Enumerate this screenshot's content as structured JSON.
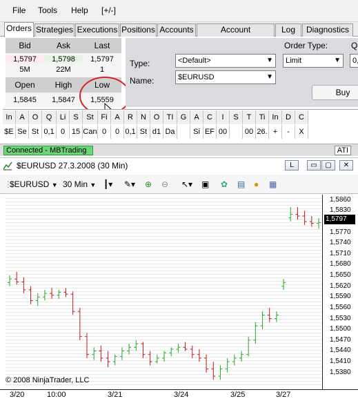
{
  "menu": {
    "file": "File",
    "tools": "Tools",
    "help": "Help",
    "toggle": "[+/-]"
  },
  "tabs": [
    "Orders",
    "Strategies",
    "Executions",
    "Positions",
    "Accounts",
    "Account Performance",
    "Log",
    "Diagnostics"
  ],
  "quote": {
    "bid_label": "Bid",
    "ask_label": "Ask",
    "last_label": "Last",
    "bid": "1,5797",
    "ask": "1,5798",
    "last": "1,5797",
    "bid_size": "5M",
    "ask_size": "22M",
    "last_size": "1",
    "open_label": "Open",
    "high_label": "High",
    "low_label": "Low",
    "open": "1,5845",
    "high": "1,5847",
    "low": "1,5559"
  },
  "order": {
    "type_label": "Type:",
    "type_value": "<Default>",
    "name_label": "Name:",
    "name_value": "$EURUSD",
    "order_type_label": "Order Type:",
    "order_type_value": "Limit",
    "qty_label": "Q",
    "qty_value": "0,",
    "buy_label": "Buy"
  },
  "columns": {
    "headers": [
      "In",
      "A",
      "O",
      "Q",
      "Li",
      "S",
      "St",
      "Fi",
      "A",
      "R",
      "N",
      "O",
      "TI",
      "G",
      "A",
      "C",
      "I",
      "S",
      "T",
      "Ti",
      "In",
      "D",
      "C"
    ],
    "values": [
      "$E",
      "Se",
      "St",
      "0,1",
      "0",
      "15",
      "Can",
      "0",
      "0",
      "0,1",
      "St",
      "d1",
      "Da",
      "",
      "Si",
      "EF",
      "00",
      "",
      "00",
      "26.",
      "+",
      "-",
      "X"
    ]
  },
  "status": {
    "connection": "Connected - MBTrading",
    "ati": "ATI"
  },
  "chart_window": {
    "title": "$EURUSD  27.3.2008 (30 Min)",
    "btn_l": "L",
    "btn_min": "▭",
    "btn_max": "▢",
    "btn_close": "✕"
  },
  "toolbar": {
    "instrument": "$EURUSD",
    "interval": "30 Min"
  },
  "chart_data": {
    "type": "bar",
    "instrument": "$EURUSD",
    "interval": "30 Min",
    "ylim": [
      1.5345,
      1.5865
    ],
    "y_ticks": [
      "1,5860",
      "1,5830",
      "1,5800",
      "1,5770",
      "1,5740",
      "1,5710",
      "1,5680",
      "1,5650",
      "1,5620",
      "1,5590",
      "1,5560",
      "1,5530",
      "1,5500",
      "1,5470",
      "1,5440",
      "1,5410",
      "1,5380"
    ],
    "x_ticks": [
      "3/20",
      "10:00",
      "3/21",
      "3/24",
      "3/25",
      "3/27"
    ],
    "last_price": "1,5797",
    "copyright": "© 2008 NinjaTrader, LLC",
    "bars": [
      [
        1.563,
        1.565,
        1.562,
        1.564
      ],
      [
        1.564,
        1.566,
        1.5625,
        1.5632
      ],
      [
        1.5632,
        1.5645,
        1.56,
        1.561
      ],
      [
        1.561,
        1.562,
        1.557,
        1.558
      ],
      [
        1.558,
        1.56,
        1.5565,
        1.559
      ],
      [
        1.559,
        1.561,
        1.558,
        1.56
      ],
      [
        1.56,
        1.5615,
        1.5585,
        1.5595
      ],
      [
        1.5595,
        1.561,
        1.5585,
        1.5603
      ],
      [
        1.5603,
        1.5615,
        1.559,
        1.5598
      ],
      [
        1.5598,
        1.5605,
        1.554,
        1.555
      ],
      [
        1.555,
        1.556,
        1.547,
        1.548
      ],
      [
        1.548,
        1.549,
        1.542,
        1.543
      ],
      [
        1.543,
        1.545,
        1.5415,
        1.544
      ],
      [
        1.544,
        1.5455,
        1.541,
        1.542
      ],
      [
        1.542,
        1.544,
        1.5395,
        1.541
      ],
      [
        1.541,
        1.543,
        1.54,
        1.5425
      ],
      [
        1.5425,
        1.545,
        1.5415,
        1.544
      ],
      [
        1.544,
        1.546,
        1.543,
        1.545
      ],
      [
        1.545,
        1.547,
        1.544,
        1.546
      ],
      [
        1.546,
        1.5465,
        1.542,
        1.543
      ],
      [
        1.543,
        1.544,
        1.54,
        1.541
      ],
      [
        1.541,
        1.543,
        1.5405,
        1.542
      ],
      [
        1.542,
        1.544,
        1.541,
        1.5435
      ],
      [
        1.5435,
        1.545,
        1.5425,
        1.5445
      ],
      [
        1.5445,
        1.546,
        1.5435,
        1.545
      ],
      [
        1.545,
        1.5465,
        1.544,
        1.5445
      ],
      [
        1.5445,
        1.5455,
        1.542,
        1.543
      ],
      [
        1.543,
        1.5445,
        1.541,
        1.542
      ],
      [
        1.542,
        1.543,
        1.538,
        1.539
      ],
      [
        1.539,
        1.541,
        1.536,
        1.537
      ],
      [
        1.537,
        1.54,
        1.536,
        1.539
      ],
      [
        1.539,
        1.542,
        1.538,
        1.541
      ],
      [
        1.541,
        1.543,
        1.54,
        1.542
      ],
      [
        1.542,
        1.544,
        1.541,
        1.543
      ],
      [
        1.543,
        1.548,
        1.5425,
        1.547
      ],
      [
        1.547,
        1.552,
        1.546,
        1.551
      ],
      [
        1.551,
        1.555,
        1.55,
        1.554
      ],
      [
        1.554,
        1.556,
        1.552,
        1.553
      ],
      [
        1.553,
        1.555,
        1.552,
        1.554
      ],
      [
        1.562,
        1.564,
        1.561,
        1.563
      ],
      [
        1.581,
        1.584,
        1.58,
        1.582
      ],
      [
        1.582,
        1.584,
        1.5805,
        1.5815
      ],
      [
        1.5815,
        1.583,
        1.579,
        1.58
      ],
      [
        1.58,
        1.5815,
        1.5785,
        1.5795
      ],
      [
        1.5795,
        1.581,
        1.578,
        1.5797
      ]
    ]
  }
}
